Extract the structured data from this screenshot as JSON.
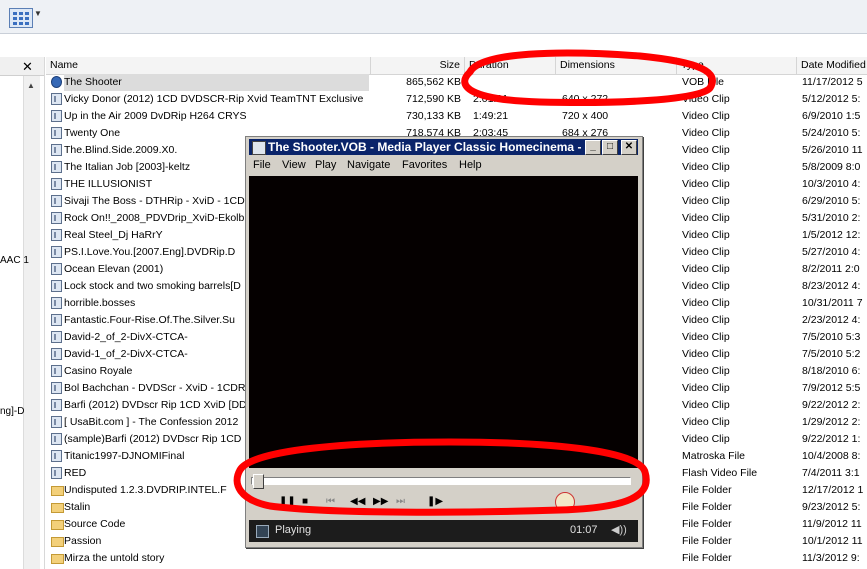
{
  "left_pane": {
    "close_label": "✕",
    "fragments": [
      "AAC 1",
      "ng]-D"
    ]
  },
  "columns": {
    "name": "Name",
    "size": "Size",
    "duration": "Duration",
    "dimensions": "Dimensions",
    "type": "Type",
    "date_modified": "Date Modified"
  },
  "files": [
    {
      "icon": "vob",
      "name": "The Shooter",
      "size": "865,562 KB",
      "duration": "",
      "dimensions": "",
      "type": "VOB File",
      "date": "11/17/2012 5"
    },
    {
      "icon": "file",
      "name": "Vicky Donor (2012) 1CD DVDSCR-Rip Xvid TeamTNT Exclusive",
      "size": "712,590 KB",
      "duration": "2:01:01",
      "dimensions": "640 x 272",
      "type": "Video Clip",
      "date": "5/12/2012 5:"
    },
    {
      "icon": "file",
      "name": "Up in the Air 2009 DvDRip H264 CRYS",
      "size": "730,133 KB",
      "duration": "1:49:21",
      "dimensions": "720 x 400",
      "type": "Video Clip",
      "date": "6/9/2010 1:5"
    },
    {
      "icon": "file",
      "name": "Twenty One",
      "size": "718,574 KB",
      "duration": "2:03:45",
      "dimensions": "684 x 276",
      "type": "Video Clip",
      "date": "5/24/2010 5:"
    },
    {
      "icon": "file",
      "name": "The.Blind.Side.2009.X0.",
      "size": "",
      "duration": "",
      "dimensions": "",
      "type": "Video Clip",
      "date": "5/26/2010 11"
    },
    {
      "icon": "file",
      "name": "The Italian Job [2003]-keltz",
      "size": "",
      "duration": "",
      "dimensions": "",
      "type": "Video Clip",
      "date": "5/8/2009 8:0"
    },
    {
      "icon": "file",
      "name": "THE ILLUSIONIST",
      "size": "",
      "duration": "",
      "dimensions": "",
      "type": "Video Clip",
      "date": "10/3/2010 4:"
    },
    {
      "icon": "file",
      "name": "Sivaji The Boss - DTHRip - XviD - 1CD",
      "size": "",
      "duration": "",
      "dimensions": "",
      "type": "Video Clip",
      "date": "6/29/2010 5:"
    },
    {
      "icon": "file",
      "name": "Rock On!!_2008_PDVDrip_XviD-Ekolb",
      "size": "",
      "duration": "",
      "dimensions": "",
      "type": "Video Clip",
      "date": "5/31/2010 2:"
    },
    {
      "icon": "file",
      "name": "Real Steel_Dj HaRrY",
      "size": "",
      "duration": "",
      "dimensions": "",
      "type": "Video Clip",
      "date": "1/5/2012 12:"
    },
    {
      "icon": "file",
      "name": "PS.I.Love.You.[2007.Eng].DVDRip.D",
      "size": "",
      "duration": "",
      "dimensions": "",
      "type": "Video Clip",
      "date": "5/27/2010 4:"
    },
    {
      "icon": "file",
      "name": "Ocean Elevan (2001)",
      "size": "",
      "duration": "",
      "dimensions": "",
      "type": "Video Clip",
      "date": "8/2/2011 2:0"
    },
    {
      "icon": "file",
      "name": "Lock stock and two smoking barrels[D",
      "size": "",
      "duration": "",
      "dimensions": "",
      "type": "Video Clip",
      "date": "8/23/2012 4:"
    },
    {
      "icon": "file",
      "name": "horrible.bosses",
      "size": "",
      "duration": "",
      "dimensions": "",
      "type": "Video Clip",
      "date": "10/31/2011 7"
    },
    {
      "icon": "file",
      "name": "Fantastic.Four-Rise.Of.The.Silver.Su",
      "size": "",
      "duration": "",
      "dimensions": "",
      "type": "Video Clip",
      "date": "2/23/2012 4:"
    },
    {
      "icon": "file",
      "name": "David-2_of_2-DivX-CTCA-",
      "size": "",
      "duration": "",
      "dimensions": "",
      "type": "Video Clip",
      "date": "7/5/2010 5:3"
    },
    {
      "icon": "file",
      "name": "David-1_of_2-DivX-CTCA-",
      "size": "",
      "duration": "",
      "dimensions": "",
      "type": "Video Clip",
      "date": "7/5/2010 5:2"
    },
    {
      "icon": "file",
      "name": "Casino Royale",
      "size": "",
      "duration": "",
      "dimensions": "",
      "type": "Video Clip",
      "date": "8/18/2010 6:"
    },
    {
      "icon": "file",
      "name": "Bol Bachchan - DVDScr - XviD - 1CDR",
      "size": "",
      "duration": "",
      "dimensions": "",
      "type": "Video Clip",
      "date": "7/9/2012 5:5"
    },
    {
      "icon": "file",
      "name": "Barfi (2012) DVDscr Rip 1CD XviD [DD",
      "size": "",
      "duration": "",
      "dimensions": "",
      "type": "Video Clip",
      "date": "9/22/2012 2:"
    },
    {
      "icon": "file",
      "name": "[ UsaBit.com ] - The Confession 2012",
      "size": "",
      "duration": "",
      "dimensions": "",
      "type": "Video Clip",
      "date": "1/29/2012 2:"
    },
    {
      "icon": "file",
      "name": "(sample)Barfi (2012) DVDscr Rip 1CD",
      "size": "",
      "duration": "",
      "dimensions": "",
      "type": "Video Clip",
      "date": "9/22/2012 1:"
    },
    {
      "icon": "file",
      "name": "Titanic1997-DJNOMIFinal",
      "size": "",
      "duration": "",
      "dimensions": "",
      "type": "Matroska File",
      "date": "10/4/2008 8:"
    },
    {
      "icon": "file",
      "name": "RED",
      "size": "",
      "duration": "",
      "dimensions": "",
      "type": "Flash Video File",
      "date": "7/4/2011 3:1"
    },
    {
      "icon": "folder",
      "name": "Undisputed 1.2.3.DVDRIP.INTEL.F",
      "size": "",
      "duration": "",
      "dimensions": "",
      "type": "File Folder",
      "date": "12/17/2012 1"
    },
    {
      "icon": "folder",
      "name": "Stalin",
      "size": "",
      "duration": "",
      "dimensions": "",
      "type": "File Folder",
      "date": "9/23/2012 5:"
    },
    {
      "icon": "folder",
      "name": "Source Code",
      "size": "",
      "duration": "",
      "dimensions": "",
      "type": "File Folder",
      "date": "11/9/2012 11"
    },
    {
      "icon": "folder",
      "name": "Passion",
      "size": "",
      "duration": "",
      "dimensions": "",
      "type": "File Folder",
      "date": "10/1/2012 11"
    },
    {
      "icon": "folder",
      "name": "Mirza the untold story",
      "size": "",
      "duration": "",
      "dimensions": "",
      "type": "File Folder",
      "date": "11/3/2012 9:"
    }
  ],
  "player": {
    "title": "The Shooter.VOB - Media Player Classic Homecinema - ...",
    "menu": [
      "File",
      "View",
      "Play",
      "Navigate",
      "Favorites",
      "Help"
    ],
    "status": "Playing",
    "time": "01:07",
    "accent": "#0a246a",
    "annotation_color": "#ff0000"
  }
}
